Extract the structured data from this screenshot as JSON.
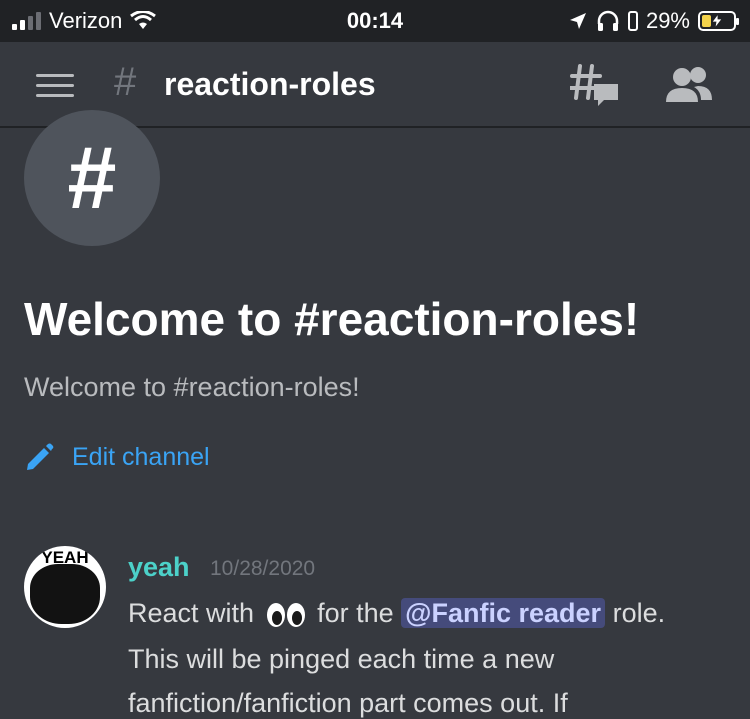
{
  "status_bar": {
    "carrier": "Verizon",
    "time": "00:14",
    "battery": "29%",
    "battery_level": 0.29,
    "icons": [
      "signal-icon",
      "wifi-icon",
      "location-icon",
      "headphones-icon",
      "battery-icon"
    ]
  },
  "header": {
    "hash": "#",
    "channel_name": "reaction-roles",
    "icons": [
      "hamburger-menu-icon",
      "threads-icon",
      "members-icon"
    ]
  },
  "channel_intro": {
    "avatar_glyph": "#",
    "title": "Welcome to #reaction-roles!",
    "subtitle": "Welcome to #reaction-roles!",
    "edit_label": "Edit channel"
  },
  "message": {
    "author": "yeah",
    "avatar_text": "YEAH",
    "timestamp": "10/28/2020",
    "line1_before": "React with",
    "line1_after": "for the",
    "mention": "@Fanfic reader",
    "line1_end": "role.",
    "line2": "This will be pinged each time a new",
    "line3": "fanfiction/fanfiction part comes out.  If"
  },
  "colors": {
    "background": "#36393f",
    "author": "#4cd1c9",
    "link": "#3aa4f5",
    "mention_bg": "#454b7b"
  }
}
